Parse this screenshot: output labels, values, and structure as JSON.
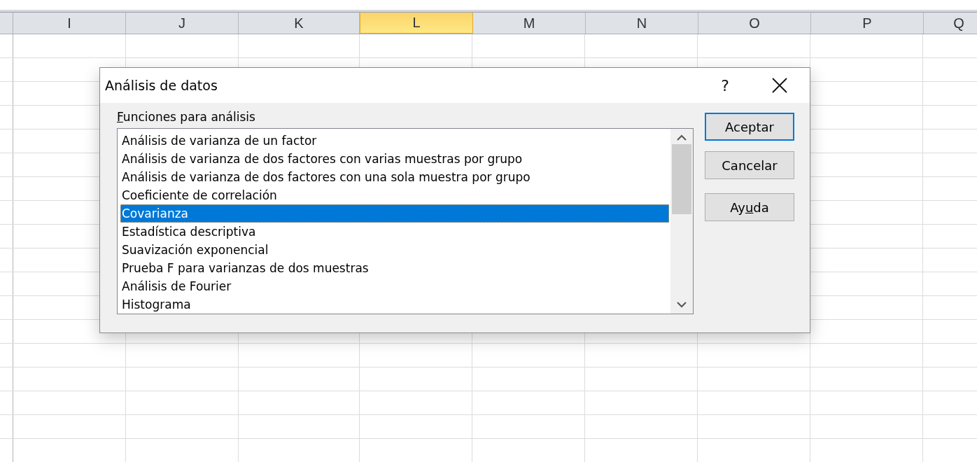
{
  "sheet": {
    "columns": [
      {
        "label": "I",
        "selected": false
      },
      {
        "label": "J",
        "selected": false
      },
      {
        "label": "K",
        "selected": false
      },
      {
        "label": "L",
        "selected": true
      },
      {
        "label": "M",
        "selected": false
      },
      {
        "label": "N",
        "selected": false
      },
      {
        "label": "O",
        "selected": false
      },
      {
        "label": "P",
        "selected": false
      },
      {
        "label": "Q",
        "selected": false
      }
    ]
  },
  "dialog": {
    "title": "Análisis de datos",
    "help": "?",
    "list_label": {
      "key": "F",
      "after": "unciones para análisis"
    },
    "items": [
      {
        "label": "Análisis de varianza de un factor",
        "selected": false
      },
      {
        "label": "Análisis de varianza de dos factores con varias muestras por grupo",
        "selected": false
      },
      {
        "label": "Análisis de varianza de dos factores con una sola muestra por grupo",
        "selected": false
      },
      {
        "label": "Coeficiente de correlación",
        "selected": false
      },
      {
        "label": "Covarianza",
        "selected": true
      },
      {
        "label": "Estadística descriptiva",
        "selected": false
      },
      {
        "label": "Suavización exponencial",
        "selected": false
      },
      {
        "label": "Prueba F para varianzas de dos muestras",
        "selected": false
      },
      {
        "label": "Análisis de Fourier",
        "selected": false
      },
      {
        "label": "Histograma",
        "selected": false
      }
    ],
    "buttons": [
      {
        "before": "Aceptar",
        "default": true
      },
      {
        "before": "Cancelar",
        "default": false
      },
      {
        "before": "Ay",
        "key": "u",
        "after": "da",
        "default": false
      }
    ]
  }
}
